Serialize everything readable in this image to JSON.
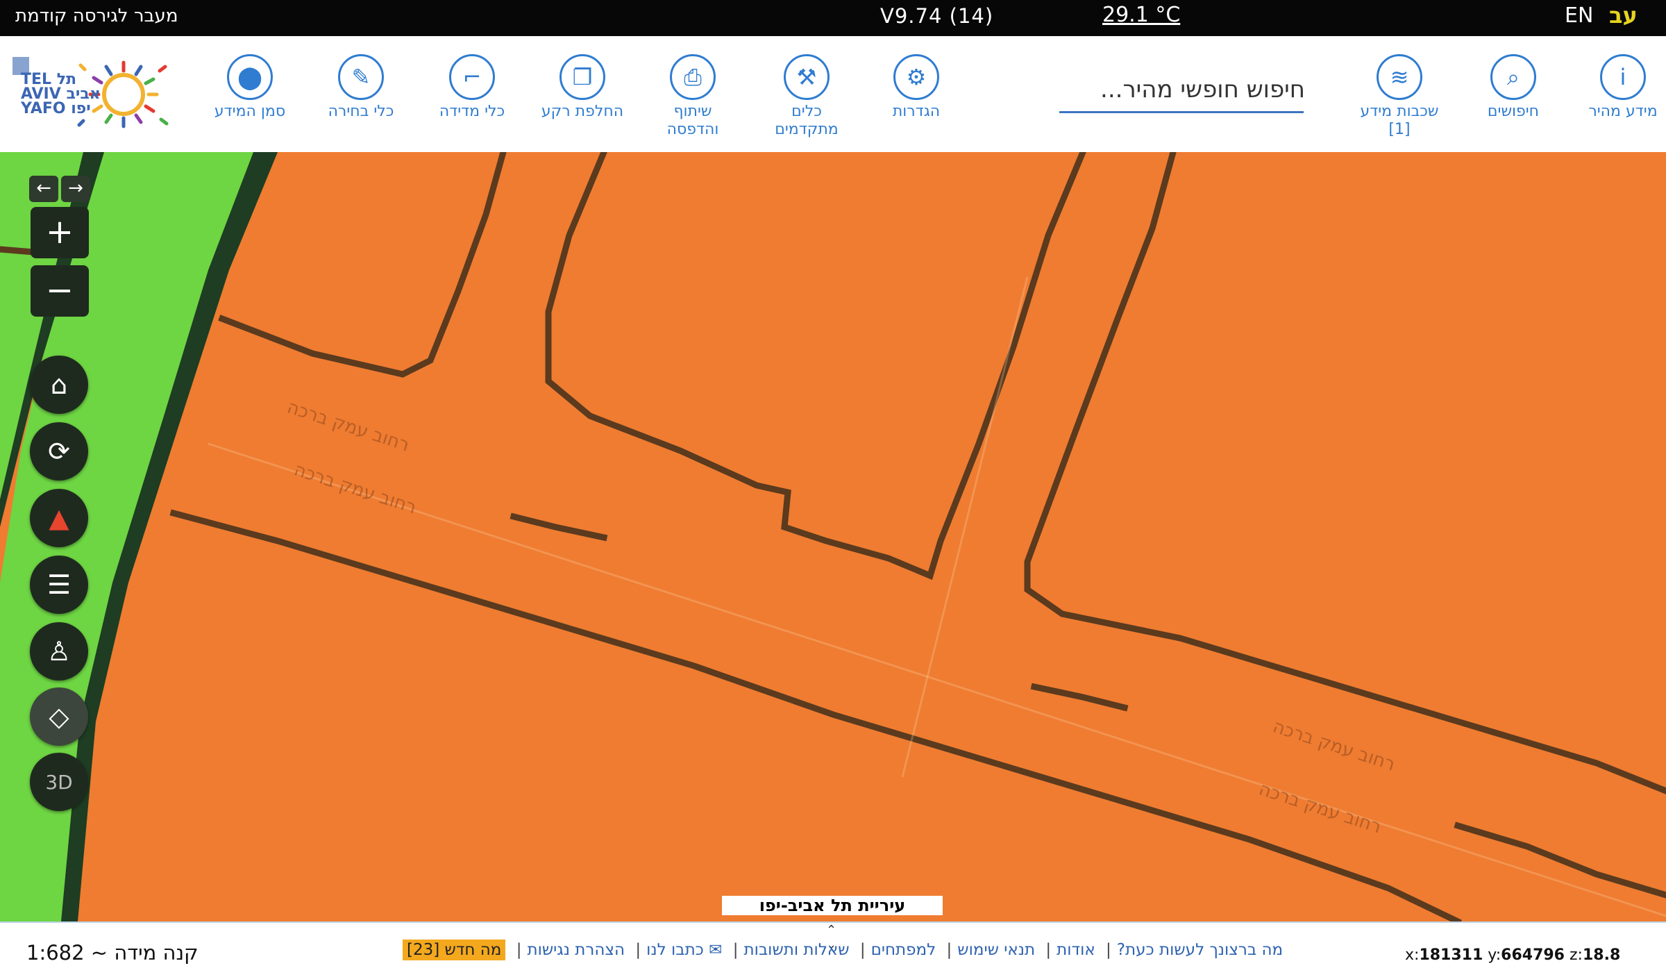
{
  "topbar": {
    "prev_version": "מעבר לגירסה קודמת",
    "version": "V9.74 (14)",
    "temperature": "29.1 °C",
    "lang_en": "EN",
    "lang_he": "עב"
  },
  "logo": {
    "text_line1": "TEL תל",
    "text_line2": "AVIV אביב",
    "text_line3": "YAFO יפו"
  },
  "toolbar": {
    "quick_info": "מידע מהיר",
    "searches": "חיפושים",
    "layers": "שכבות מידע",
    "layers_count": "[1]",
    "search_placeholder": "חיפוש חופשי מהיר...",
    "settings": "הגדרות",
    "advanced_tools_1": "כלים",
    "advanced_tools_2": "מתקדמים",
    "share_print_1": "שיתוף",
    "share_print_2": "והדפסה",
    "basemap": "החלפת רקע",
    "measure": "כלי מדידה",
    "select": "כלי בחירה",
    "marker": "סמן המידע"
  },
  "map": {
    "street_label": "רחוב עמק ברכה",
    "city_label": "עיריית תל אביב-יפו",
    "colors": {
      "land": "#ef7c31",
      "park": "#6ed543",
      "street_line": "#5b3a1e"
    }
  },
  "controls": {
    "nav_back": "←",
    "nav_fwd": "→",
    "zoom_in": "+",
    "zoom_out": "−",
    "three_d": "3D",
    "icons": [
      "home-icon",
      "refresh-icon",
      "compass-icon",
      "list-icon",
      "streetview-person-icon",
      "eraser-icon"
    ]
  },
  "bottom": {
    "scale": "קנה מידה ~ 1:682",
    "links": {
      "what_now": "מה ברצונך לעשות כעת?",
      "about": "אודות",
      "terms": "תנאי שימוש",
      "developers": "למפתחים",
      "faq": "שאלות ותשובות",
      "contact": "כתבו לנו",
      "accessibility": "הצהרת נגישות",
      "news": "מה חדש [23]"
    },
    "coords": {
      "x_label": "x:",
      "x": "181311",
      "y_label": "y:",
      "y": "664796",
      "z_label": "z:",
      "z": "18.8"
    }
  }
}
